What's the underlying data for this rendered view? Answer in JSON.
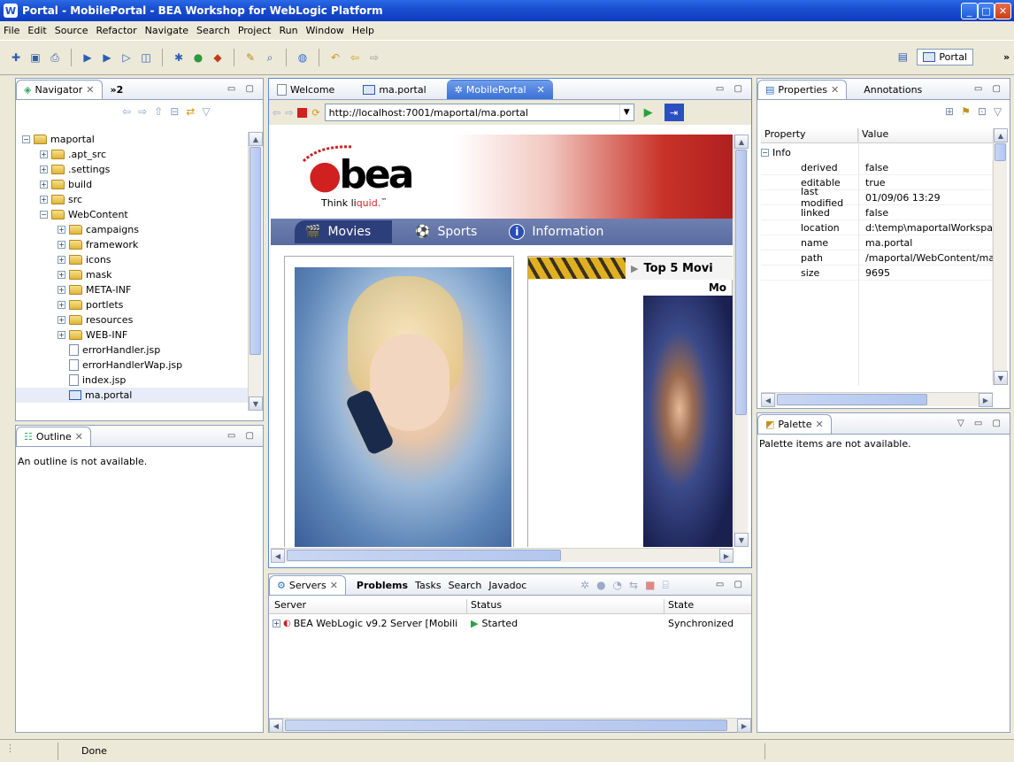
{
  "window": {
    "title": "Portal - MobilePortal - BEA Workshop for WebLogic Platform"
  },
  "menu": [
    "File",
    "Edit",
    "Source",
    "Refactor",
    "Navigate",
    "Search",
    "Project",
    "Run",
    "Window",
    "Help"
  ],
  "perspective": {
    "label": "Portal",
    "overflow": "»"
  },
  "navigator": {
    "tab_label": "Navigator",
    "overflow_label": "»2",
    "root": "maportal",
    "items": [
      {
        "label": ".apt_src",
        "kind": "folder",
        "level": 1
      },
      {
        "label": ".settings",
        "kind": "folder",
        "level": 1
      },
      {
        "label": "build",
        "kind": "folder",
        "level": 1
      },
      {
        "label": "src",
        "kind": "folder",
        "level": 1
      },
      {
        "label": "WebContent",
        "kind": "folder-open",
        "level": 1
      },
      {
        "label": "campaigns",
        "kind": "folder",
        "level": 2
      },
      {
        "label": "framework",
        "kind": "folder",
        "level": 2
      },
      {
        "label": "icons",
        "kind": "folder",
        "level": 2
      },
      {
        "label": "mask",
        "kind": "folder",
        "level": 2
      },
      {
        "label": "META-INF",
        "kind": "folder",
        "level": 2
      },
      {
        "label": "portlets",
        "kind": "folder",
        "level": 2
      },
      {
        "label": "resources",
        "kind": "folder",
        "level": 2
      },
      {
        "label": "WEB-INF",
        "kind": "folder",
        "level": 2
      },
      {
        "label": "errorHandler.jsp",
        "kind": "file",
        "level": 2
      },
      {
        "label": "errorHandlerWap.jsp",
        "kind": "file",
        "level": 2
      },
      {
        "label": "index.jsp",
        "kind": "file",
        "level": 2
      },
      {
        "label": "ma.portal",
        "kind": "portal",
        "level": 2
      }
    ]
  },
  "outline": {
    "tab_label": "Outline",
    "message": "An outline is not available."
  },
  "editor": {
    "tabs": [
      "Welcome",
      "ma.portal",
      "MobilePortal"
    ],
    "url": "http://localhost:7001/maportal/ma.portal",
    "logo_text": "bea",
    "tagline": "Think liquid.",
    "tagline_mark": "™",
    "nav": [
      "Movies",
      "Sports",
      "Information"
    ],
    "top5_label": "Top 5 Movi",
    "mo_label": "Mo"
  },
  "properties": {
    "tab_label": "Properties",
    "tab2_label": "Annotations",
    "col_property": "Property",
    "col_value": "Value",
    "group": "Info",
    "rows": [
      {
        "k": "derived",
        "v": "false"
      },
      {
        "k": "editable",
        "v": "true"
      },
      {
        "k": "last modified",
        "v": "01/09/06 13:29"
      },
      {
        "k": "linked",
        "v": "false"
      },
      {
        "k": "location",
        "v": "d:\\temp\\maportalWorkspa..."
      },
      {
        "k": "name",
        "v": "ma.portal"
      },
      {
        "k": "path",
        "v": "/maportal/WebContent/ma..."
      },
      {
        "k": "size",
        "v": "9695"
      }
    ]
  },
  "palette": {
    "tab_label": "Palette",
    "message": "Palette items are not available."
  },
  "servers": {
    "tabs": [
      "Servers",
      "Problems",
      "Tasks",
      "Search",
      "Javadoc"
    ],
    "cols": [
      "Server",
      "Status",
      "State"
    ],
    "rows": [
      {
        "server": "BEA WebLogic v9.2 Server [Mobili",
        "status": "Started",
        "state": "Synchronized"
      }
    ]
  },
  "status": {
    "text": "Done"
  }
}
